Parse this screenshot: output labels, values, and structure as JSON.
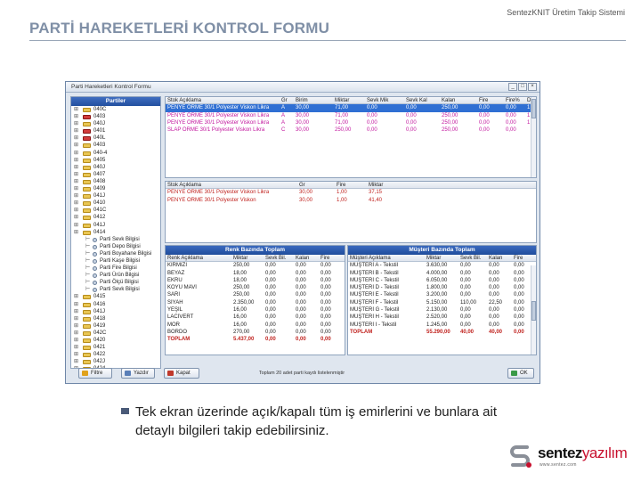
{
  "slide": {
    "title": "PARTİ HAREKETLERİ KONTROL FORMU",
    "header_right": "SentezKNIT Üretim Takip Sistemi",
    "bullet": "Tek ekran üzerinde açık/kapalı tüm iş emirlerini ve bunlara ait detaylı bilgileri takip edebilirsiniz."
  },
  "logo": {
    "brand_a": "sentez",
    "brand_b": "yazılım",
    "url": "www.sentez.com"
  },
  "window": {
    "title": "Parti Hareketleri Kontrol Formu",
    "minimize": "_",
    "maximize": "□",
    "close": "×"
  },
  "tree": {
    "header": "Partiler",
    "items": [
      {
        "label": "040C",
        "red": false
      },
      {
        "label": "0403",
        "red": true
      },
      {
        "label": "040J",
        "red": false
      },
      {
        "label": "0401",
        "red": true
      },
      {
        "label": "040L",
        "red": true
      },
      {
        "label": "0403",
        "red": false
      },
      {
        "label": "040-4",
        "red": false
      },
      {
        "label": "0405",
        "red": false
      },
      {
        "label": "040J",
        "red": false
      },
      {
        "label": "0407",
        "red": false
      },
      {
        "label": "0408",
        "red": false
      },
      {
        "label": "0409",
        "red": false
      },
      {
        "label": "041J",
        "red": false
      },
      {
        "label": "0410",
        "red": false
      },
      {
        "label": "041C",
        "red": false
      },
      {
        "label": "0412",
        "red": false
      },
      {
        "label": "041J",
        "red": false
      },
      {
        "label": "0414",
        "red": false
      }
    ],
    "children": [
      "Parti Sevk Bilgisi",
      "Parti Depo Bilgisi",
      "Parti Boyahane Bilgisi",
      "Parti Kaşe Bilgisi",
      "Parti Fire Bilgisi",
      "Parti Ürün Bilgisi",
      "Parti Ölçü Bilgisi",
      "Parti Sevk Bilgisi"
    ],
    "tail": [
      {
        "label": "0415",
        "red": false
      },
      {
        "label": "0416",
        "red": false
      },
      {
        "label": "041J",
        "red": false
      },
      {
        "label": "0418",
        "red": false
      },
      {
        "label": "0419",
        "red": false
      },
      {
        "label": "042C",
        "red": false
      },
      {
        "label": "0420",
        "red": false
      },
      {
        "label": "0421",
        "red": false
      },
      {
        "label": "0422",
        "red": false
      },
      {
        "label": "042J",
        "red": false
      },
      {
        "label": "0424",
        "red": false
      },
      {
        "label": "0425",
        "red": false
      }
    ]
  },
  "top_grid": {
    "headers": [
      "Stok Açıklama",
      "Gr",
      "Birim",
      "Miktar",
      "Sevk Mik",
      "Sevk Kal",
      "Kalan",
      "Fire",
      "Fire%",
      "D"
    ],
    "rows": [
      {
        "cells": [
          "PENYE ÖRME 30/1 Polyester Viskon Likra",
          "A",
          "30,00",
          "71,00",
          "0,00",
          "0,00",
          "250,00",
          "0,00",
          "0,00",
          "1"
        ],
        "style": "sel"
      },
      {
        "cells": [
          "PENYE ÖRME 30/1 Polyester Viskon Likra",
          "A",
          "30,00",
          "71,00",
          "0,00",
          "0,00",
          "250,00",
          "0,00",
          "0,00",
          "1"
        ],
        "style": "magenta"
      },
      {
        "cells": [
          "PENYE ÖRME 30/1 Polyester Viskon Likra",
          "A",
          "30,00",
          "71,00",
          "0,00",
          "0,00",
          "250,00",
          "0,00",
          "0,00",
          "1"
        ],
        "style": "magenta"
      },
      {
        "cells": [
          "SLAP ÖRME 30/1 Polyester Viskon Likra",
          "C",
          "30,00",
          "250,00",
          "0,00",
          "0,00",
          "250,00",
          "0,00",
          "0,00",
          ""
        ],
        "style": "magenta"
      }
    ]
  },
  "mid_grid": {
    "headers": [
      "Stok Açıklama",
      "Gr",
      "Fire",
      "Miktar"
    ],
    "rows": [
      {
        "cells": [
          "PENYE ÖRME 30/1 Polyester Viskon Likra",
          "30,00",
          "1,00",
          "37,15"
        ],
        "style": "red"
      },
      {
        "cells": [
          "PENYE ÖRME 30/1 Polyester Viskon",
          "30,00",
          "1,00",
          "41,40"
        ],
        "style": "red"
      }
    ]
  },
  "left_bottom": {
    "bar": "Renk Bazında Toplam",
    "headers": [
      "Renk Açıklama",
      "Miktar",
      "Sevk Bil.",
      "Kalan",
      "Fire"
    ],
    "rows": [
      {
        "cells": [
          "KIRMIZI",
          "250,00",
          "0,00",
          "0,00",
          "0,00"
        ],
        "style": ""
      },
      {
        "cells": [
          "BEYAZ",
          "18,00",
          "0,00",
          "0,00",
          "0,00"
        ],
        "style": ""
      },
      {
        "cells": [
          "EKRU",
          "18,00",
          "0,00",
          "0,00",
          "0,00"
        ],
        "style": ""
      },
      {
        "cells": [
          "KOYU MAVİ",
          "250,00",
          "0,00",
          "0,00",
          "0,00"
        ],
        "style": ""
      },
      {
        "cells": [
          "SARI",
          "250,00",
          "0,00",
          "0,00",
          "0,00"
        ],
        "style": ""
      },
      {
        "cells": [
          "SİYAH",
          "2.350,00",
          "0,00",
          "0,00",
          "0,00"
        ],
        "style": ""
      },
      {
        "cells": [
          "YEŞİL",
          "16,00",
          "0,00",
          "0,00",
          "0,00"
        ],
        "style": ""
      },
      {
        "cells": [
          "LACİVERT",
          "16,00",
          "0,00",
          "0,00",
          "0,00"
        ],
        "style": ""
      },
      {
        "cells": [
          "MOR",
          "16,00",
          "0,00",
          "0,00",
          "0,00"
        ],
        "style": ""
      },
      {
        "cells": [
          "BORDO",
          "270,00",
          "0,00",
          "0,00",
          "0,00"
        ],
        "style": ""
      },
      {
        "cells": [
          "TOPLAM",
          "5.437,00",
          "0,00",
          "0,00",
          "0,00"
        ],
        "style": "total"
      }
    ]
  },
  "right_bottom": {
    "bar": "Müşteri Bazında Toplam",
    "headers": [
      "Müşteri Açıklama",
      "Miktar",
      "Sevk Bil.",
      "Kalan",
      "Fire"
    ],
    "rows": [
      {
        "cells": [
          "MÜŞTERİ A - Tekstil",
          "3.630,00",
          "0,00",
          "0,00",
          "0,00"
        ],
        "style": ""
      },
      {
        "cells": [
          "MÜŞTERİ B - Tekstil",
          "4.000,00",
          "0,00",
          "0,00",
          "0,00"
        ],
        "style": ""
      },
      {
        "cells": [
          "MÜŞTERİ C - Tekstil",
          "6.050,00",
          "0,00",
          "0,00",
          "0,00"
        ],
        "style": ""
      },
      {
        "cells": [
          "MÜŞTERİ D - Tekstil",
          "1.800,00",
          "0,00",
          "0,00",
          "0,00"
        ],
        "style": ""
      },
      {
        "cells": [
          "MÜŞTERİ E - Tekstil",
          "3.200,00",
          "0,00",
          "0,00",
          "0,00"
        ],
        "style": ""
      },
      {
        "cells": [
          "MÜŞTERİ F - Tekstil",
          "5.150,00",
          "110,00",
          "22,50",
          "0,00"
        ],
        "style": ""
      },
      {
        "cells": [
          "MÜŞTERİ G - Tekstil",
          "2.130,00",
          "0,00",
          "0,00",
          "0,00"
        ],
        "style": ""
      },
      {
        "cells": [
          "MÜŞTERİ H - Tekstil",
          "2.520,00",
          "0,00",
          "0,00",
          "0,00"
        ],
        "style": ""
      },
      {
        "cells": [
          "MÜŞTERİ I - Tekstil",
          "1.245,00",
          "0,00",
          "0,00",
          "0,00"
        ],
        "style": ""
      },
      {
        "cells": [
          "TOPLAM",
          "55.290,00",
          "40,00",
          "40,00",
          "0,00"
        ],
        "style": "total"
      }
    ]
  },
  "footer": {
    "btn_filter": "Filtre",
    "btn_print": "Yazdır",
    "btn_close": "Kapat",
    "btn_ok": "OK",
    "status": "Toplam 20 adet parti kaydı listelenmiştir"
  }
}
